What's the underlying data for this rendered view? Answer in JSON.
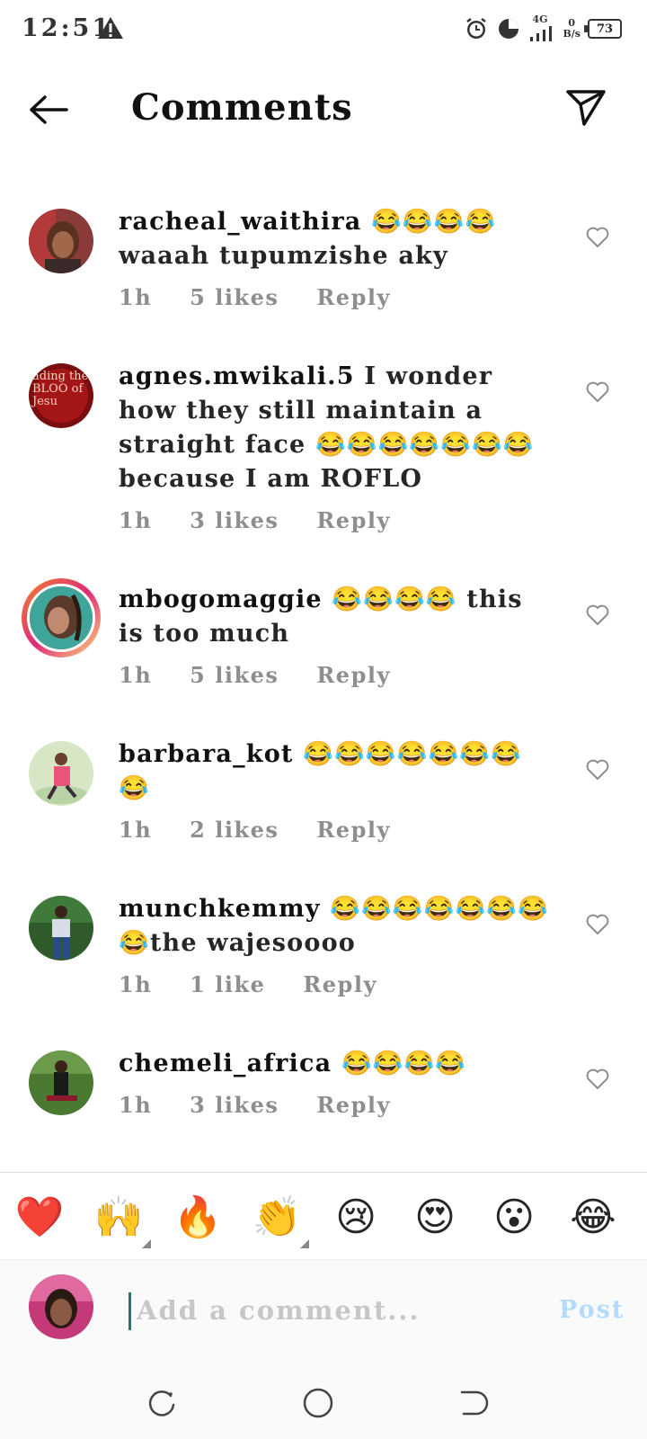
{
  "status": {
    "time": "12:51",
    "network": "4G",
    "net_speed_value": "0",
    "net_speed_unit": "B/s",
    "battery": "73"
  },
  "header": {
    "title": "Comments"
  },
  "comments": [
    {
      "username": "racheal_waithira",
      "text": " 😂😂😂😂 waaah tupumzishe aky",
      "time": "1h",
      "likes": "5 likes",
      "reply": "Reply"
    },
    {
      "username": "agnes.mwikali.5",
      "text": " I wonder how they still maintain a straight face 😂😂😂😂😂😂😂because I am ROFLO",
      "time": "1h",
      "likes": "3 likes",
      "reply": "Reply",
      "avatar_text": "ading the BLOO of Jesu"
    },
    {
      "username": "mbogomaggie",
      "text": " 😂😂😂😂 this is too much",
      "time": "1h",
      "likes": "5 likes",
      "reply": "Reply"
    },
    {
      "username": "barbara_kot",
      "text": " 😂😂😂😂😂😂😂😂",
      "time": "1h",
      "likes": "2 likes",
      "reply": "Reply"
    },
    {
      "username": "munchkemmy",
      "text": " 😂😂😂😂😂😂😂😂the wajesoooo",
      "time": "1h",
      "likes": "1 like",
      "reply": "Reply"
    },
    {
      "username": "chemeli_africa",
      "text": " 😂😂😂😂",
      "time": "1h",
      "likes": "3 likes",
      "reply": "Reply"
    }
  ],
  "reactions": [
    "❤️",
    "🙌",
    "🔥",
    "👏",
    "😢",
    "😍",
    "😮",
    "😂"
  ],
  "composer": {
    "placeholder": "Add a comment...",
    "post_label": "Post"
  },
  "colors": {
    "accent": "#0095f6",
    "post_disabled": "#b3dbff",
    "meta": "#8e8e8e"
  }
}
